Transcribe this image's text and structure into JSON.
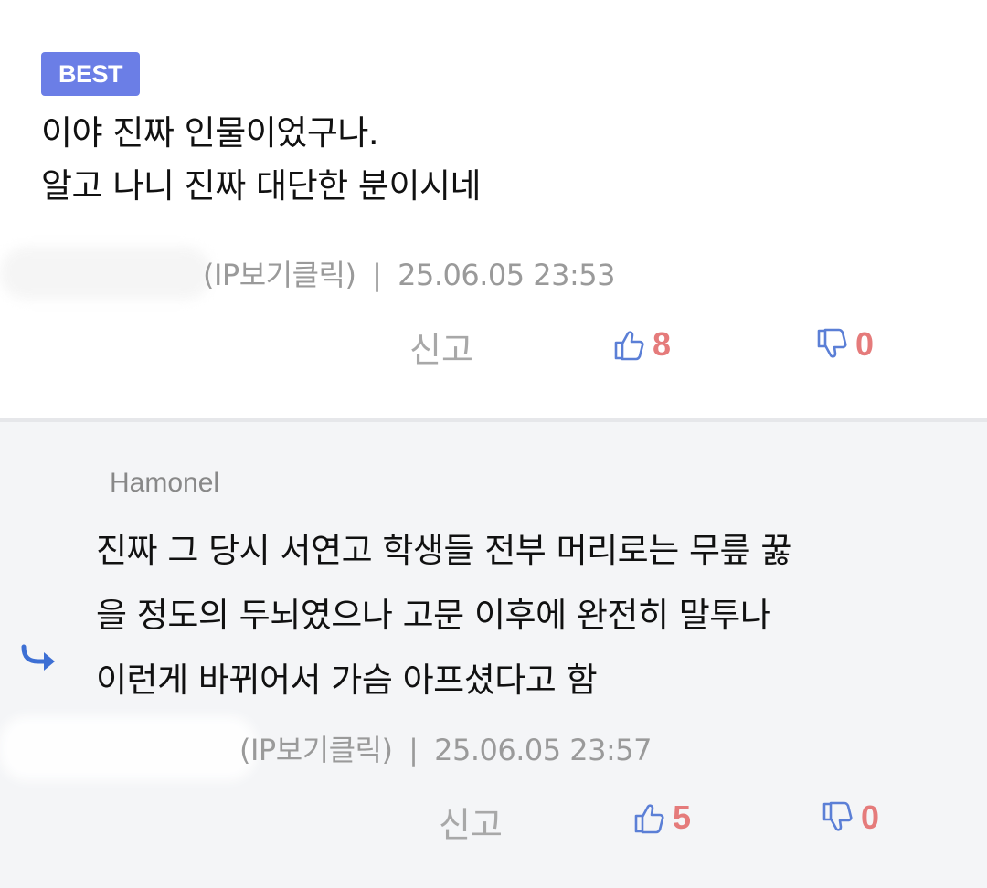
{
  "comments": [
    {
      "badge": "BEST",
      "author": "",
      "body_lines": [
        "이야 진짜 인물이었구나.",
        "알고 나니 진짜 대단한 분이시네"
      ],
      "ip_label": "(IP보기클릭)",
      "separator": "|",
      "timestamp": "25.06.05 23:53",
      "report_label": "신고",
      "likes": "8",
      "dislikes": "0"
    },
    {
      "badge": "",
      "author": "Hamonel",
      "body_lines": [
        "진짜 그 당시 서연고 학생들 전부 머리로는 무릎 꿇",
        "을 정도의 두뇌였으나 고문 이후에 완전히 말투나",
        "이런게 바뀌어서 가슴 아프셨다고 함"
      ],
      "ip_label": "(IP보기클릭)",
      "separator": "|",
      "timestamp": "25.06.05 23:57",
      "report_label": "신고",
      "likes": "5",
      "dislikes": "0"
    }
  ],
  "icons": {
    "like": "thumbs-up-icon",
    "dislike": "thumbs-down-icon",
    "reply": "reply-arrow-icon"
  },
  "colors": {
    "badge_bg": "#6b7ee6",
    "vote_count": "#e57b7b",
    "icon_blue": "#5b7fd6",
    "reply_bg": "#f4f5f7",
    "meta_text": "#9a9a9a"
  }
}
